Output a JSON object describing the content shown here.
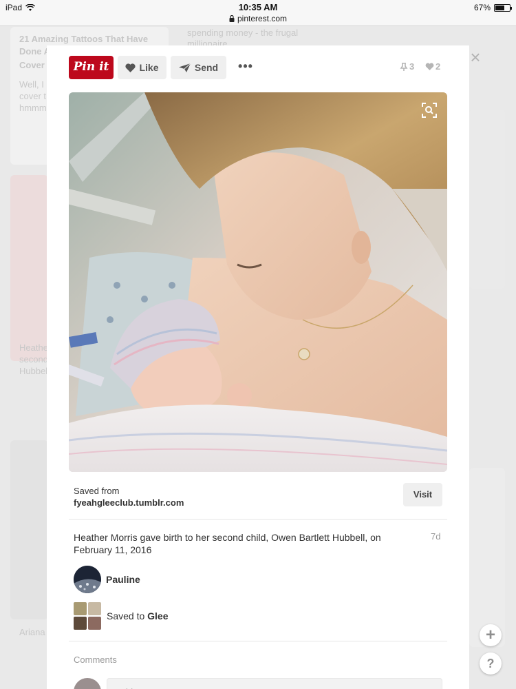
{
  "status_bar": {
    "device": "iPad",
    "time": "10:35 AM",
    "url": "pinterest.com",
    "battery": "67%",
    "battery_level": 0.67
  },
  "background": {
    "left_title": "21 Amazing Tattoos That Have Done A",
    "left_title_2": "Cover",
    "left_snippet": "Well, I",
    "left_snippet_2": "cover t",
    "left_snippet_3": "hmmm",
    "middle_snippet": "spending money - the frugal",
    "middle_snippet_2": "millionaire",
    "left_lower": "Heathe",
    "left_lower_2": "second",
    "left_lower_3": "Hubbel",
    "left_bottom": "Ariana"
  },
  "toolbar": {
    "pin_label": "Pin it",
    "like_label": "Like",
    "send_label": "Send",
    "more_label": "•••",
    "repin_count": "3",
    "like_count": "2"
  },
  "close_label": "×",
  "source": {
    "saved_from_label": "Saved from",
    "domain": "fyeahgleeclub.tumblr.com",
    "visit_label": "Visit"
  },
  "pin": {
    "description": "Heather Morris gave birth to her second child, Owen Bartlett Hubbell, on February 11, 2016",
    "age": "7d"
  },
  "user": {
    "name": "Pauline"
  },
  "board": {
    "saved_to_prefix": "Saved to",
    "board_name": "Glee"
  },
  "comments": {
    "label": "Comments",
    "placeholder": "Add a comment"
  },
  "floating": {
    "add_label": "+",
    "help_label": "?"
  }
}
